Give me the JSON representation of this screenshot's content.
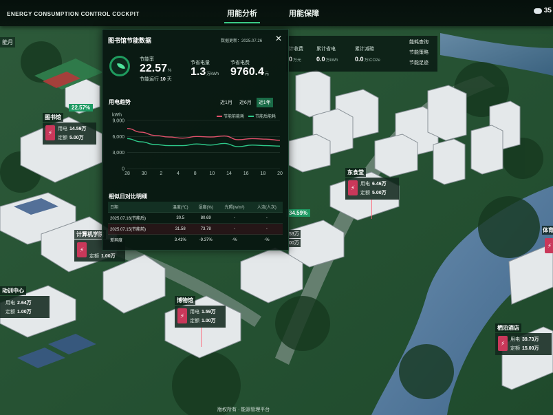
{
  "app_title": "ENERGY CONSUMPTION CONTROL COCKPIT",
  "nav": [
    "用能分析",
    "用能保障"
  ],
  "weather": {
    "icon": "cloud-icon",
    "temp": "35"
  },
  "left_tag": "能月",
  "stat_strip": [
    {
      "label": "计收费",
      "value": "0",
      "unit": "万元"
    },
    {
      "label": "累计省电",
      "value": "0.0",
      "unit": "万kWh"
    },
    {
      "label": "累计减碳",
      "value": "0.0",
      "unit": "万tCO2e"
    }
  ],
  "side_menu": [
    "能耗查询",
    "节能策略",
    "节能足迹"
  ],
  "panel": {
    "title": "图书馆节能数据",
    "updated_label": "数据更新：",
    "updated": "2025.07.26",
    "saving_rate_label": "节能率",
    "saving_rate": "22.57",
    "saving_rate_unit": "%",
    "days_label": "节能运行",
    "days": "10",
    "days_unit": "天",
    "saved_power_label": "节省电量",
    "saved_power": "1.3",
    "saved_power_unit": "万kWh",
    "saved_cost_label": "节省电费",
    "saved_cost": "9760.4",
    "saved_cost_unit": "元",
    "trend_title": "用电趋势",
    "range_tabs": [
      "近1月",
      "近6月",
      "近1年"
    ],
    "table_title": "相似日对比明细",
    "table_headers": [
      "日期",
      "温度(℃)",
      "湿度(%)",
      "光照(w/m²)",
      "人流(人次)"
    ],
    "table_rows": [
      [
        "2025.07.16(节能后)",
        "30.5",
        "80.69",
        "-",
        "-"
      ],
      [
        "2025.07.15(节能前)",
        "31.58",
        "73.78",
        "-",
        "-"
      ],
      [
        "差异度",
        "3.41%",
        "-9.37%",
        "-%",
        "-%"
      ]
    ]
  },
  "chart_data": {
    "type": "line",
    "ylabel": "kWh",
    "ylim": [
      0,
      9000
    ],
    "yticks": [
      0,
      3000,
      6000,
      9000
    ],
    "x": [
      "28",
      "30",
      "2",
      "4",
      "6",
      "8",
      "10",
      "12",
      "14",
      "16",
      "18",
      "20"
    ],
    "xtick_labels": [
      "28",
      "30",
      "2",
      "4",
      "8",
      "10",
      "14",
      "16",
      "18",
      "20"
    ],
    "series": [
      {
        "name": "节能前能耗",
        "color": "#e0506a",
        "values": [
          7500,
          6800,
          6200,
          5900,
          5700,
          6000,
          5900,
          6100,
          5400,
          5600,
          5500,
          5300
        ]
      },
      {
        "name": "节能后能耗",
        "color": "#2ec98a",
        "values": [
          5600,
          5000,
          4500,
          4300,
          4300,
          4600,
          4400,
          4700,
          4100,
          4400,
          4300,
          4200
        ]
      }
    ]
  },
  "badges": {
    "library_rate": "22.57%",
    "canteen_rate": "34.59%"
  },
  "pins": [
    {
      "name": "图书馆",
      "use_label": "用电",
      "use": "14.59万",
      "quota_label": "定额",
      "quota": "5.00万"
    },
    {
      "name": "东食堂",
      "use_label": "用电",
      "use": "6.46万",
      "quota_label": "定额",
      "quota": "5.00万"
    },
    {
      "name": "计算机学院",
      "use_label": "",
      "use": "",
      "quota_label": "定额",
      "quota": "1.00万"
    },
    {
      "name": "动训中心",
      "use_label": "用电",
      "use": "2.64万",
      "quota_label": "定额",
      "quota": "1.00万"
    },
    {
      "name": "博物馆",
      "use_label": "用电",
      "use": "1.59万",
      "quota_label": "定额",
      "quota": "1.00万"
    },
    {
      "name": "体育馆",
      "use_label": "",
      "use": "",
      "quota_label": "",
      "quota": ""
    },
    {
      "name": "栖泊酒店",
      "use_label": "用电",
      "use": "39.73万",
      "quota_label": "定额",
      "quota": "15.00万"
    }
  ],
  "fragments": [
    "53万",
    "00万"
  ],
  "bottom_text": "版权所有 · 能源管理平台"
}
